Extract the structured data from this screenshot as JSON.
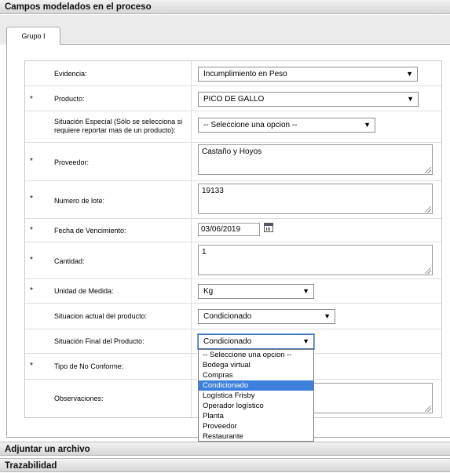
{
  "sections": {
    "campos": "Campos modelados en el proceso",
    "adjuntar": "Adjuntar un archivo",
    "trazabilidad": "Trazabilidad"
  },
  "tabs": [
    {
      "label": "Grupo I"
    }
  ],
  "fields": {
    "evidencia": {
      "label": "Evidencia:",
      "value": "Incumplimiento en Peso"
    },
    "producto": {
      "required": "*",
      "label": "Producto:",
      "value": "PICO DE GALLO"
    },
    "situacion_especial": {
      "label": "Situación Especial (Sólo se selecciona si requiere reportar mas de un producto):",
      "value": "-- Seleccione una opcion --"
    },
    "proveedor": {
      "required": "*",
      "label": "Proveedor:",
      "value": "Castaño y Hoyos"
    },
    "lote": {
      "required": "*",
      "label": "Numero de lote:",
      "value": "19133"
    },
    "vencimiento": {
      "required": "*",
      "label": "Fecha de Vencimiento:",
      "value": "03/06/2019"
    },
    "cantidad": {
      "required": "*",
      "label": "Cantidad:",
      "value": "1"
    },
    "unidad": {
      "required": "*",
      "label": "Unidad de Medida:",
      "value": "Kg"
    },
    "situacion_actual": {
      "label": "Situacion actual del producto:",
      "value": "Condicionado"
    },
    "situacion_final": {
      "label": "Situación Final del Producto:",
      "value": "Condicionado"
    },
    "tipo_no_conforme": {
      "required": "*",
      "label": "Tipo de No Conforme:"
    },
    "observaciones": {
      "label": "Observaciones:",
      "value": ""
    }
  },
  "dropdown_options": [
    "-- Seleccione una opcion --",
    "Bodega virtual",
    "Compras",
    "Condicionado",
    "Logística Frisby",
    "Operador logístico",
    "Planta",
    "Proveedor",
    "Restaurante"
  ],
  "dropdown_selected": "Condicionado",
  "icons": {
    "arrow": "▼",
    "calendar": "calendar-icon"
  },
  "colors": {
    "highlight": "#3d7fdc",
    "header_bg": "#dcdcdc"
  }
}
